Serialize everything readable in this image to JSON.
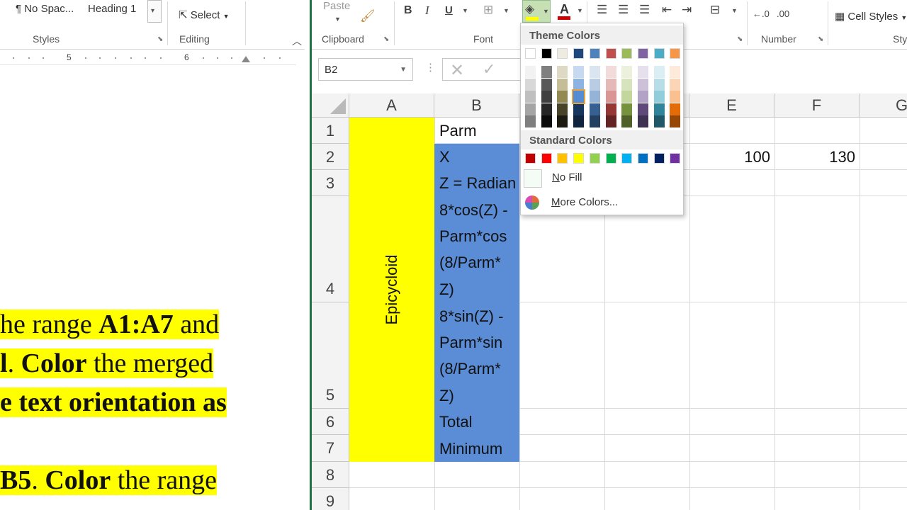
{
  "word": {
    "styles": {
      "no_spacing": "¶ No Spac...",
      "heading1": "Heading 1",
      "group_label": "Styles"
    },
    "editing": {
      "select_label": "Select",
      "group_label": "Editing"
    },
    "ruler": {
      "num5": "5",
      "num6": "6"
    },
    "document": {
      "line1": {
        "a": "he range ",
        "b": "A1:A7",
        "c": " and"
      },
      "line2": {
        "a": "l",
        "b": ". ",
        "c": "Color",
        "d": " the merged"
      },
      "line3": {
        "a": "e text orientation as"
      },
      "line4": {
        "a": " B5",
        "b": ". ",
        "c": "Color",
        "d": " the range"
      }
    }
  },
  "excel": {
    "ribbon": {
      "paste": "Paste",
      "clipboard": "Clipboard",
      "font": "Font",
      "number": "Number",
      "cell_styles": "Cell Styles",
      "styles_partial": "Sty"
    },
    "formula_bar": {
      "name_box": "B2"
    },
    "columns": [
      "A",
      "B",
      "C",
      "D",
      "E",
      "F",
      "G"
    ],
    "rows": [
      "1",
      "2",
      "3",
      "4",
      "5",
      "6",
      "7",
      "8",
      "9"
    ],
    "cells": {
      "a_merged": "Epicycloid",
      "b1": "Parm",
      "b2": "X",
      "b3": "Z = Radian",
      "b4_1": "8*cos(Z) -",
      "b4_2": "Parm*cos",
      "b4_3": "(8/Parm*",
      "b4_4": "Z)",
      "b5_1": "8*sin(Z) -",
      "b5_2": "Parm*sin",
      "b5_3": "(8/Parm*",
      "b5_4": "Z)",
      "b6": "Total",
      "b7": "Minimum",
      "e2": "100",
      "f2": "130"
    },
    "color_dropdown": {
      "theme_header": "Theme Colors",
      "standard_header": "Standard Colors",
      "no_fill": "No Fill",
      "more_colors": "More Colors..."
    },
    "colors": {
      "fill_yellow": "#FFFF00",
      "fill_blue": "#5B8DD6",
      "excel_green": "#217346"
    }
  }
}
